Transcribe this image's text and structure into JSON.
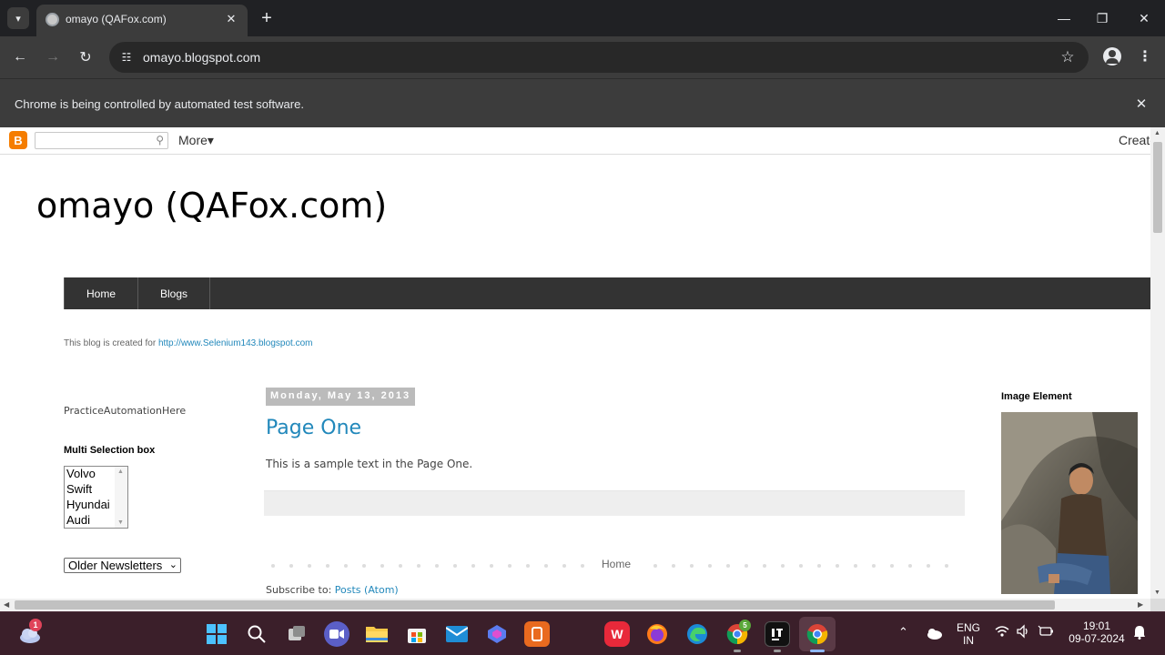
{
  "browser": {
    "tab_title": "omayo (QAFox.com)",
    "url": "omayo.blogspot.com",
    "infobar_text": "Chrome is being controlled by automated test software."
  },
  "blogger_nav": {
    "more_label": "More▾",
    "create_label": "Create"
  },
  "blog": {
    "title": "omayo (QAFox.com)",
    "tabs": [
      {
        "label": "Home"
      },
      {
        "label": "Blogs"
      }
    ],
    "description_prefix": "This blog is created for ",
    "description_link": "http://www.Selenium143.blogspot.com"
  },
  "sidebar_left": {
    "practice_text": "PracticeAutomationHere",
    "multi_select_title": "Multi Selection box",
    "multi_options": [
      "Volvo",
      "Swift",
      "Hyundai",
      "Audi"
    ],
    "dropdown_value": "Older Newsletters"
  },
  "post": {
    "date": "Monday, May 13, 2013",
    "title": "Page One",
    "body": "This is a sample text in the Page One.",
    "home_link": "Home",
    "subscribe_prefix": "Subscribe to: ",
    "subscribe_link": "Posts (Atom)"
  },
  "sidebar_right": {
    "image_title": "Image Element"
  },
  "taskbar": {
    "weather_badge": "1",
    "chrome_badge": "5",
    "lang_line1": "ENG",
    "lang_line2": "IN",
    "time": "19:01",
    "date": "09-07-2024"
  },
  "colors": {
    "tab_bg": "#3c3c3c",
    "titlebar": "#202124",
    "nav_tabs": "#333333",
    "link": "#2288bb",
    "taskbar": "#3b1f2a"
  }
}
